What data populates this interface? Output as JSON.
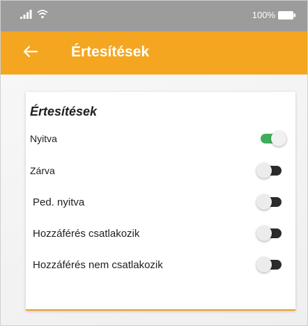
{
  "status_bar": {
    "battery_percent": "100%",
    "signal_icon": "signal-bars-icon",
    "wifi_icon": "wifi-icon",
    "battery_icon": "battery-icon"
  },
  "app_bar": {
    "title": "Értesítések",
    "back_icon": "arrow-left-icon",
    "background_color": "#f4a621"
  },
  "card": {
    "title": "Értesítések",
    "items": [
      {
        "label": "Nyitva",
        "enabled": true
      },
      {
        "label": "Zárva",
        "enabled": false
      },
      {
        "label": "Ped. nyitva",
        "enabled": false
      },
      {
        "label": "Hozzáférés csatlakozik",
        "enabled": false
      },
      {
        "label": "Hozzáférés nem csatlakozik",
        "enabled": false
      }
    ]
  },
  "colors": {
    "toggle_on": "#3fae5a",
    "toggle_off": "#2b2b2b",
    "card_accent": "#f39a2b"
  }
}
